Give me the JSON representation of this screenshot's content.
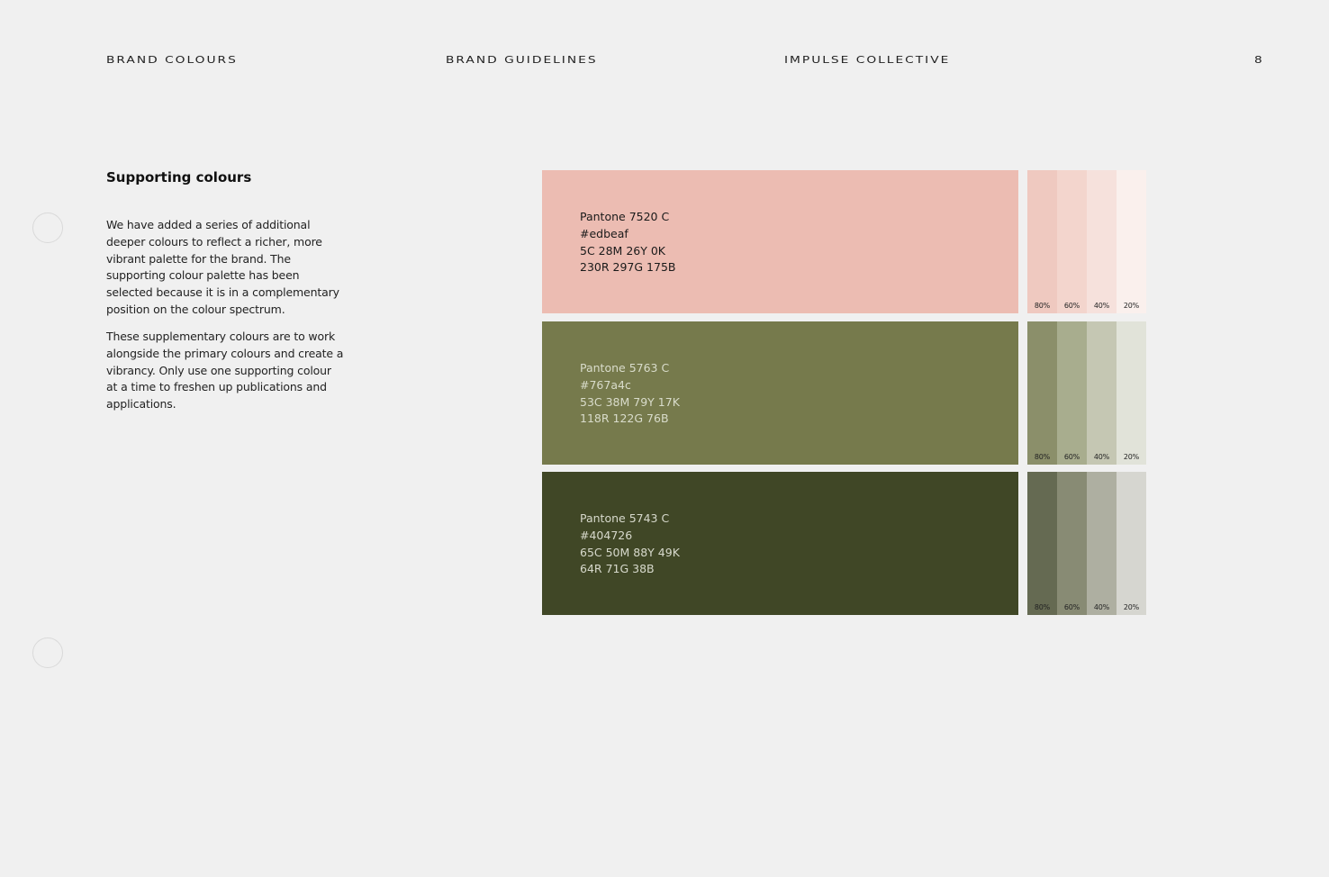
{
  "header": {
    "section": "BRAND COLOURS",
    "document": "BRAND GUIDELINES",
    "company": "IMPULSE COLLECTIVE",
    "page_number": "8"
  },
  "content": {
    "title": "Supporting colours",
    "paragraphs": [
      "We have added a series of additional deeper colours to reflect a richer, more vibrant palette for the brand. The supporting colour palette has been selected because it is in a complementary position on the colour spectrum.",
      "These supplementary colours are to work alongside the primary colours and create a vibrancy. Only use one supporting colour at a time to freshen up publications and applications."
    ]
  },
  "swatches": [
    {
      "pantone": "Pantone 7520 C",
      "hex": "#edbeaf",
      "cmyk": "5C 28M 26Y 0K",
      "rgb": "230R 297G 175B",
      "color": "#ecbcb2",
      "text_color": "#1a1a1a",
      "tints": [
        {
          "label": "80%",
          "color": "#efc9c0"
        },
        {
          "label": "60%",
          "color": "#f3d5cd"
        },
        {
          "label": "40%",
          "color": "#f6e1dc"
        },
        {
          "label": "20%",
          "color": "#faf0ed"
        }
      ]
    },
    {
      "pantone": "Pantone 5763 C",
      "hex": "#767a4c",
      "cmyk": "53C 38M 79Y 17K",
      "rgb": "118R 122G 76B",
      "color": "#767a4c",
      "text_color": "#d9dccb",
      "tints": [
        {
          "label": "80%",
          "color": "#8b8f6a"
        },
        {
          "label": "60%",
          "color": "#a8ad8e"
        },
        {
          "label": "40%",
          "color": "#c5c7b3"
        },
        {
          "label": "20%",
          "color": "#e1e3d9"
        }
      ]
    },
    {
      "pantone": "Pantone 5743 C",
      "hex": "#404726",
      "cmyk": "65C 50M 88Y 49K",
      "rgb": "64R 71G 38B",
      "color": "#404726",
      "text_color": "#d7d9cc",
      "tints": [
        {
          "label": "80%",
          "color": "#656a52"
        },
        {
          "label": "60%",
          "color": "#888b74"
        },
        {
          "label": "40%",
          "color": "#aeafa1"
        },
        {
          "label": "20%",
          "color": "#d6d6d0"
        }
      ]
    }
  ]
}
